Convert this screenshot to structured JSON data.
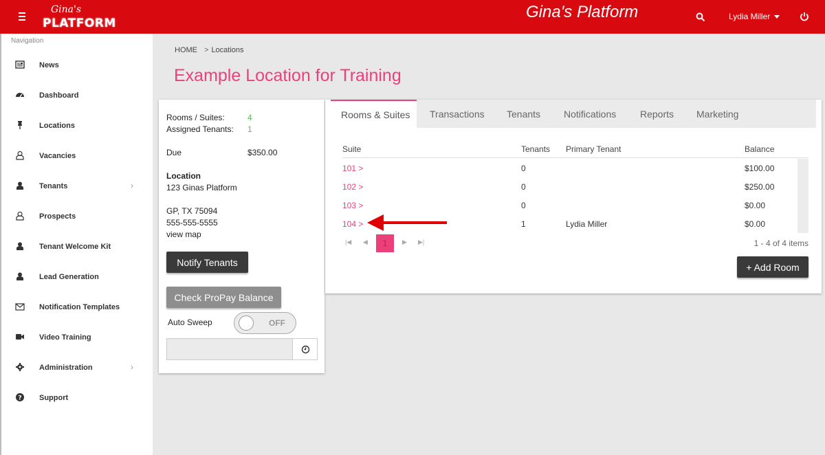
{
  "header": {
    "logo_script": "Gina's",
    "logo_word": "PLATFORM",
    "brand_title": "Gina's Platform",
    "user_name": "Lydia Miller"
  },
  "sidebar": {
    "section_label": "Navigation",
    "items": [
      {
        "label": "News",
        "icon": "newspaper-icon"
      },
      {
        "label": "Dashboard",
        "icon": "dashboard-icon"
      },
      {
        "label": "Locations",
        "icon": "pushpin-icon"
      },
      {
        "label": "Vacancies",
        "icon": "user-outline-icon"
      },
      {
        "label": "Tenants",
        "icon": "user-icon",
        "expandable": true
      },
      {
        "label": "Prospects",
        "icon": "user-outline-icon"
      },
      {
        "label": "Tenant Welcome Kit",
        "icon": "user-icon"
      },
      {
        "label": "Lead Generation",
        "icon": "user-icon"
      },
      {
        "label": "Notification Templates",
        "icon": "envelope-icon"
      },
      {
        "label": "Video Training",
        "icon": "video-camera-icon"
      },
      {
        "label": "Administration",
        "icon": "gear-icon",
        "expandable": true
      },
      {
        "label": "Support",
        "icon": "question-circle-icon"
      }
    ]
  },
  "breadcrumb": {
    "home": "HOME",
    "separator": ">",
    "current": "Locations"
  },
  "page": {
    "title": "Example Location for Training"
  },
  "summary": {
    "rooms_label": "Rooms / Suites:",
    "rooms_value": "4",
    "tenants_label": "Assigned Tenants:",
    "tenants_value": "1",
    "due_label": "Due",
    "due_value": "$350.00",
    "location_heading": "Location",
    "address_line1": "123 Ginas Platform",
    "address_line2": "GP, TX 75094",
    "phone": "555-555-5555",
    "map_link": "view map",
    "notify_button": "Notify Tenants",
    "propay_button": "Check ProPay Balance",
    "auto_sweep_label": "Auto Sweep",
    "auto_sweep_state": "OFF",
    "sweep_value": ""
  },
  "tabs": [
    {
      "label": "Rooms & Suites",
      "active": true
    },
    {
      "label": "Transactions"
    },
    {
      "label": "Tenants"
    },
    {
      "label": "Notifications"
    },
    {
      "label": "Reports"
    },
    {
      "label": "Marketing"
    }
  ],
  "grid": {
    "columns": {
      "suite": "Suite",
      "tenants": "Tenants",
      "primary_tenant": "Primary Tenant",
      "balance": "Balance"
    },
    "rows": [
      {
        "suite": "101 >",
        "tenants": "0",
        "primary_tenant": "",
        "balance": "$100.00"
      },
      {
        "suite": "102 >",
        "tenants": "0",
        "primary_tenant": "",
        "balance": "$250.00"
      },
      {
        "suite": "103 >",
        "tenants": "0",
        "primary_tenant": "",
        "balance": "$0.00"
      },
      {
        "suite": "104 >",
        "tenants": "1",
        "primary_tenant": "Lydia Miller",
        "balance": "$0.00"
      }
    ],
    "pager": {
      "current_page": "1",
      "summary": "1 - 4 of 4 items"
    },
    "add_button": "+ Add Room"
  },
  "colors": {
    "brand_red": "#d80a10",
    "accent_pink": "#ec407a",
    "count_green": "#5cb85c",
    "annotation_arrow": "#e00000"
  }
}
